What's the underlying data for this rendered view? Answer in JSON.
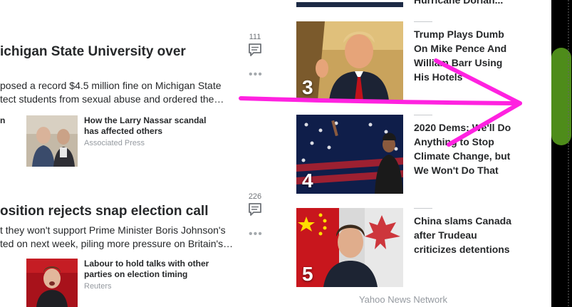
{
  "stories": [
    {
      "title": "ichigan State University over",
      "summary_lines": [
        "posed a record $4.5 million fine on Michigan State",
        "tect students from sexual abuse and ordered the…"
      ],
      "comment_count": "111",
      "related": {
        "left_fragment": "n",
        "title": "How the Larry Nassar scandal has affected others",
        "source": "Associated Press"
      }
    },
    {
      "title": "osition rejects snap election call",
      "summary_lines": [
        "t they won't support Prime Minister Boris Johnson's",
        "ted on next week, piling more pressure on Britain's…"
      ],
      "comment_count": "226",
      "related": {
        "title": "Labour to hold talks with other parties on election timing",
        "source": "Reuters"
      }
    }
  ],
  "trending": {
    "top_partial_title": "Hurricane Dorian...",
    "items": [
      {
        "rank": "3",
        "title": "Trump Plays Dumb On Mike Pence And William Barr Using His Hotels"
      },
      {
        "rank": "4",
        "title": "2020 Dems: We'll Do Anything to Stop Climate Change, but We Won't Do That"
      },
      {
        "rank": "5",
        "title": "China slams Canada after Trudeau criticizes detentions"
      }
    ],
    "footer": "Yahoo News Network"
  },
  "annotation": {
    "arrow_color": "#ff22e0"
  },
  "colors": {
    "scroll_thumb": "#4e8c1a",
    "strip": "#000000"
  }
}
